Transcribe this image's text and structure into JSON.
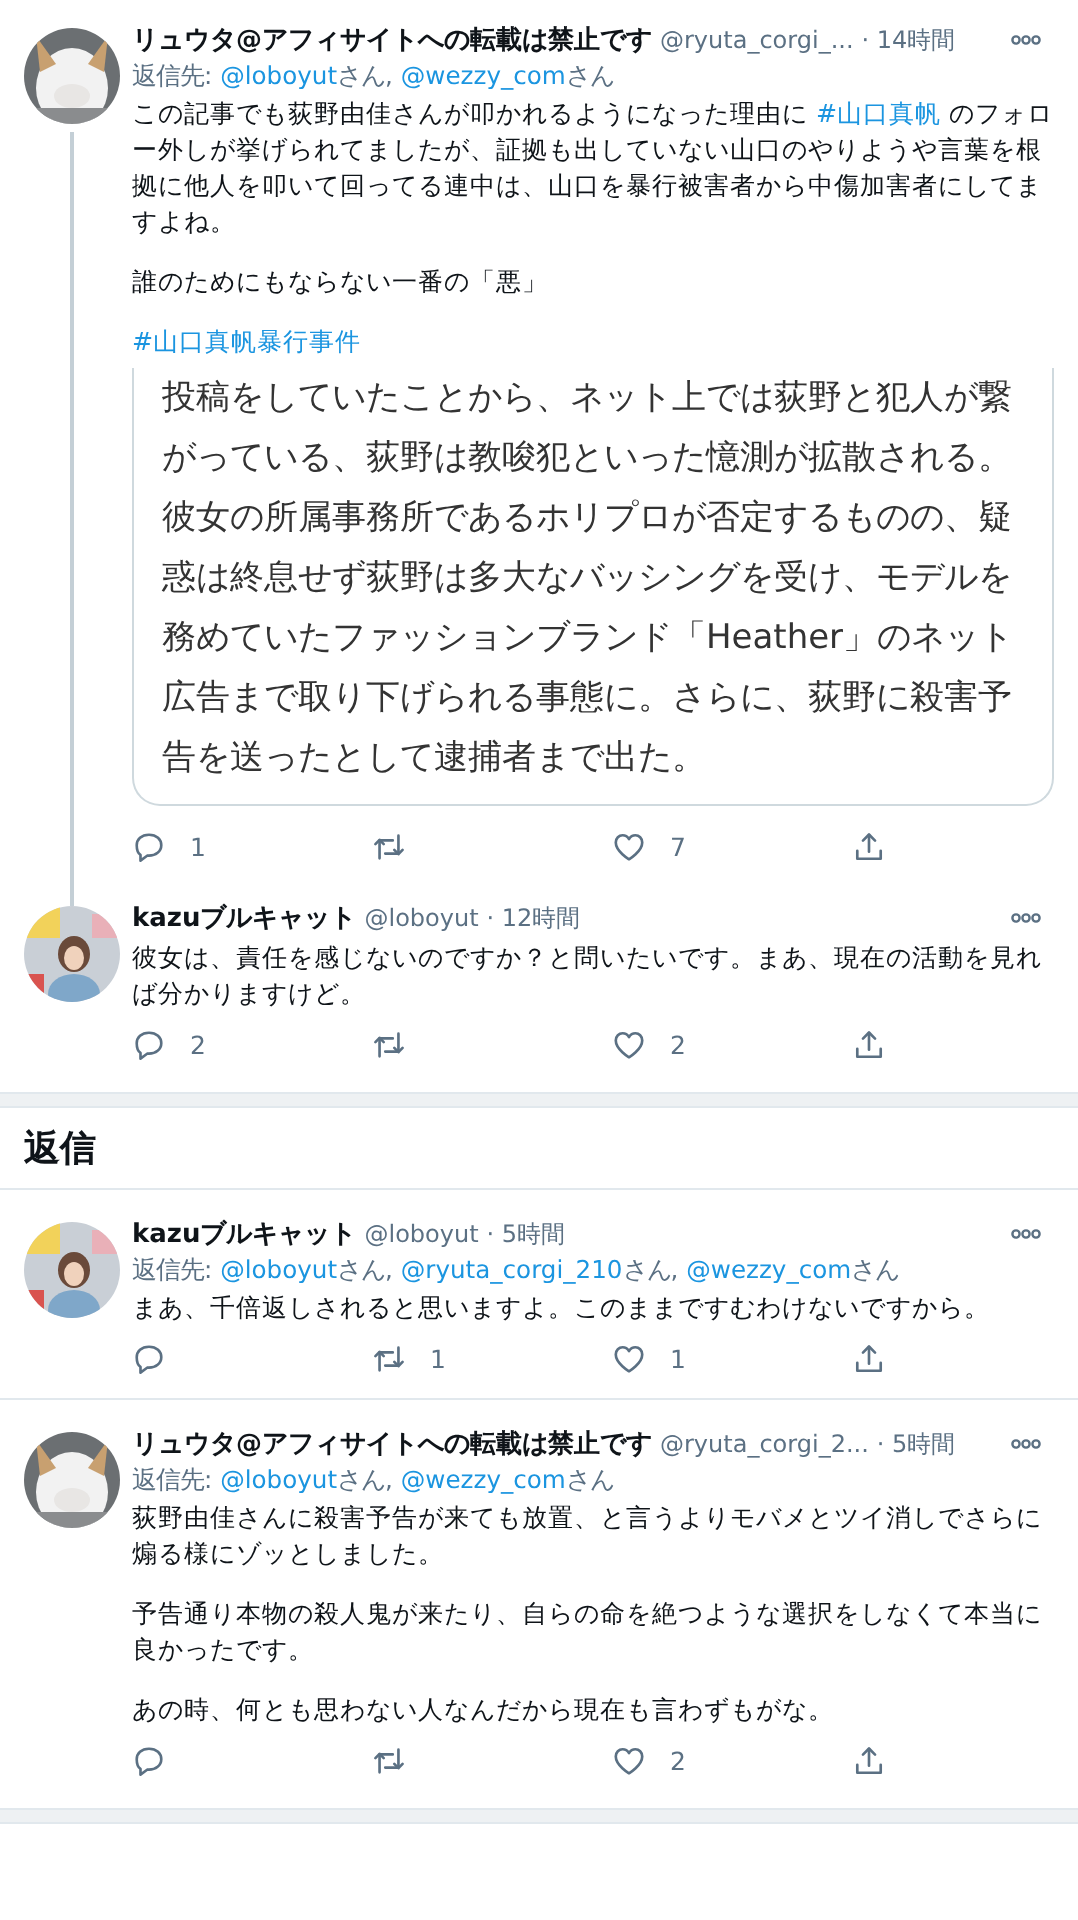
{
  "thread": [
    {
      "name": "リュウタ@アフィサイトへの転載は禁止です",
      "handle": "@ryuta_corgi_...",
      "time": "· 14時間",
      "connector": true,
      "reply_to": {
        "prefix": "返信先: ",
        "mentions": [
          {
            "handle": "@loboyut",
            "suffix": "さん, "
          },
          {
            "handle": "@wezzy_com",
            "suffix": "さん"
          }
        ]
      },
      "paragraphs": [
        [
          {
            "text": "この記事でも荻野由佳さんが叩かれるようになった理由に "
          },
          {
            "text": "#山口真帆",
            "link": true
          },
          {
            "text": " のフォロー外しが挙げられてましたが、証拠も出していない山口のやりようや言葉を根拠に他人を叩いて回ってる連中は、山口を暴行被害者から中傷加害者にしてますよね。"
          }
        ],
        [
          {
            "text": "誰のためにもならない一番の「悪」"
          }
        ],
        [
          {
            "text": "#山口真帆暴行事件",
            "link": true
          }
        ]
      ],
      "quote": "投稿をしていたことから、ネット上では荻野と犯人が繋がっている、荻野は教唆犯といった憶測が拡散される。彼女の所属事務所であるホリプロが否定するものの、疑惑は終息せず荻野は多大なバッシングを受け、モデルを務めていたファッションブランド「Heather」のネット広告まで取り下げられる事態に。さらに、荻野に殺害予告を送ったとして逮捕者まで出た。",
      "actions": [
        {
          "kind": "reply",
          "count": "1"
        },
        {
          "kind": "retweet"
        },
        {
          "kind": "like",
          "count": "7"
        },
        {
          "kind": "share"
        }
      ]
    },
    {
      "name": "kazuブルキャット",
      "handle": "@loboyut",
      "time": "· 12時間",
      "connector": false,
      "paragraphs": [
        [
          {
            "text": "彼女は、責任を感じないのですか？と問いたいです。まあ、現在の活動を見れば分かりますけど。"
          }
        ]
      ],
      "actions": [
        {
          "kind": "reply",
          "count": "2"
        },
        {
          "kind": "retweet"
        },
        {
          "kind": "like",
          "count": "2"
        },
        {
          "kind": "share"
        }
      ]
    }
  ],
  "replies_heading": "返信",
  "replies": [
    {
      "name": "kazuブルキャット",
      "handle": "@loboyut",
      "time": "· 5時間",
      "connector": false,
      "reply_to": {
        "prefix": "返信先: ",
        "mentions": [
          {
            "handle": "@loboyut",
            "suffix": "さん, "
          },
          {
            "handle": "@ryuta_corgi_210",
            "suffix": "さん, "
          },
          {
            "handle": "@wezzy_com",
            "suffix": "さん"
          }
        ]
      },
      "paragraphs": [
        [
          {
            "text": "まあ、千倍返しされると思いますよ。このままですむわけないですから。"
          }
        ]
      ],
      "actions": [
        {
          "kind": "reply"
        },
        {
          "kind": "retweet",
          "count": "1"
        },
        {
          "kind": "like",
          "count": "1"
        },
        {
          "kind": "share"
        }
      ]
    },
    {
      "name": "リュウタ@アフィサイトへの転載は禁止です",
      "handle": "@ryuta_corgi_2...",
      "time": "· 5時間",
      "connector": false,
      "reply_to": {
        "prefix": "返信先: ",
        "mentions": [
          {
            "handle": "@loboyut",
            "suffix": "さん, "
          },
          {
            "handle": "@wezzy_com",
            "suffix": "さん"
          }
        ]
      },
      "paragraphs": [
        [
          {
            "text": "荻野由佳さんに殺害予告が来ても放置、と言うよりモバメとツイ消しでさらに煽る様にゾッとしました。"
          }
        ],
        [
          {
            "text": "予告通り本物の殺人鬼が来たり、自らの命を絶つような選択をしなくて本当に良かったです。"
          }
        ],
        [
          {
            "text": "あの時、何とも思わない人なんだから現在も言わずもがな。"
          }
        ]
      ],
      "actions": [
        {
          "kind": "reply"
        },
        {
          "kind": "retweet"
        },
        {
          "kind": "like",
          "count": "2"
        },
        {
          "kind": "share"
        }
      ]
    }
  ]
}
